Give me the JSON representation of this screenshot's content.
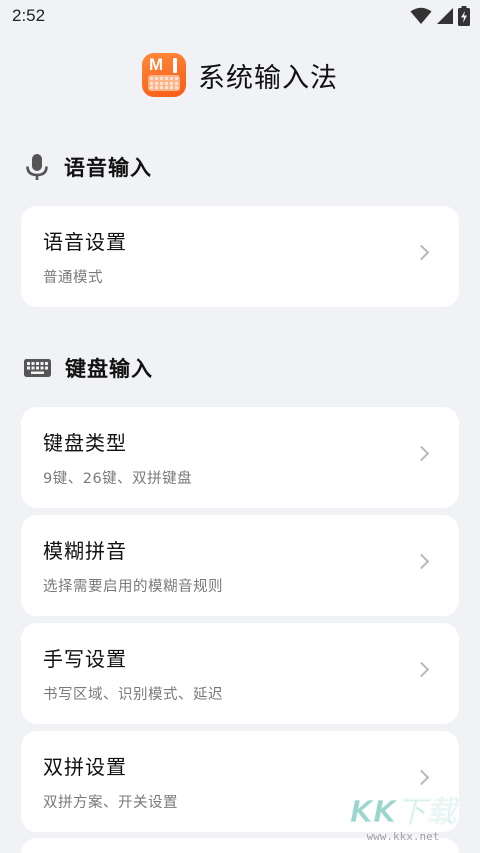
{
  "status_bar": {
    "time": "2:52"
  },
  "header": {
    "logo_letter": "M",
    "title": "系统输入法"
  },
  "sections": [
    {
      "title": "语音输入",
      "icon": "microphone-icon",
      "cards": [
        {
          "title": "语音设置",
          "subtitle": "普通模式"
        }
      ]
    },
    {
      "title": "键盘输入",
      "icon": "keyboard-icon",
      "cards": [
        {
          "title": "键盘类型",
          "subtitle": "9键、26键、双拼键盘"
        },
        {
          "title": "模糊拼音",
          "subtitle": "选择需要启用的模糊音规则"
        },
        {
          "title": "手写设置",
          "subtitle": "书写区域、识别模式、延迟"
        },
        {
          "title": "双拼设置",
          "subtitle": "双拼方案、开关设置"
        }
      ]
    }
  ],
  "watermark": {
    "logo": "KK下载",
    "url": "www.kkx.net"
  },
  "colors": {
    "background": "#f1f2f6",
    "card": "#ffffff",
    "logo_orange": "#f65a16",
    "subtitle_gray": "#7a7a7a",
    "chevron_gray": "#b8b8b8"
  }
}
